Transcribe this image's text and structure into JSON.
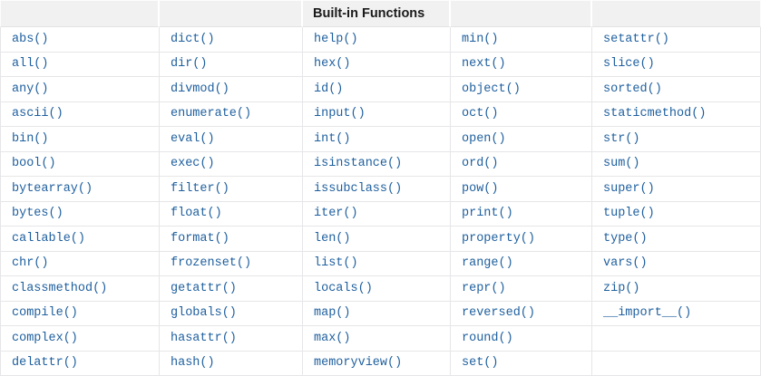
{
  "page": {
    "background": "#ffffff"
  },
  "table": {
    "title": "Built-in Functions",
    "num_columns": 5,
    "num_data_rows": 14,
    "header_cells": [
      "",
      "",
      "Built-in Functions",
      "",
      ""
    ],
    "rows": [
      [
        "abs()",
        "dict()",
        "help()",
        "min()",
        "setattr()"
      ],
      [
        "all()",
        "dir()",
        "hex()",
        "next()",
        "slice()"
      ],
      [
        "any()",
        "divmod()",
        "id()",
        "object()",
        "sorted()"
      ],
      [
        "ascii()",
        "enumerate()",
        "input()",
        "oct()",
        "staticmethod()"
      ],
      [
        "bin()",
        "eval()",
        "int()",
        "open()",
        "str()"
      ],
      [
        "bool()",
        "exec()",
        "isinstance()",
        "ord()",
        "sum()"
      ],
      [
        "bytearray()",
        "filter()",
        "issubclass()",
        "pow()",
        "super()"
      ],
      [
        "bytes()",
        "float()",
        "iter()",
        "print()",
        "tuple()"
      ],
      [
        "callable()",
        "format()",
        "len()",
        "property()",
        "type()"
      ],
      [
        "chr()",
        "frozenset()",
        "list()",
        "range()",
        "vars()"
      ],
      [
        "classmethod()",
        "getattr()",
        "locals()",
        "repr()",
        "zip()"
      ],
      [
        "compile()",
        "globals()",
        "map()",
        "reversed()",
        "__import__()"
      ],
      [
        "complex()",
        "hasattr()",
        "max()",
        "round()",
        ""
      ],
      [
        "delattr()",
        "hash()",
        "memoryview()",
        "set()",
        ""
      ]
    ],
    "colors": {
      "link": "#1e5f9e",
      "header_background": "#f1f1f2",
      "header_text": "#1a1a1a",
      "border": "#e6e6e9"
    }
  }
}
